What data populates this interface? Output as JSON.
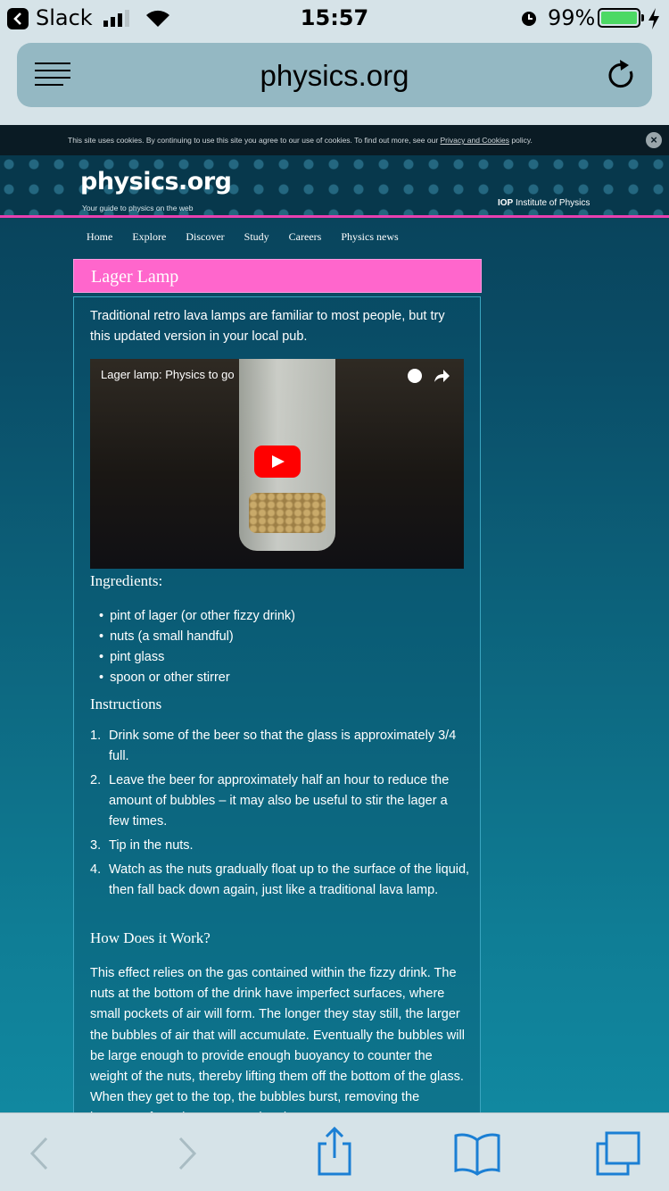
{
  "status_bar": {
    "back_app": "Slack",
    "time": "15:57",
    "battery": "99%"
  },
  "browser": {
    "url": "physics.org"
  },
  "cookie_banner": {
    "text_before": "This site uses cookies. By continuing to use this site you agree to our use of cookies. To find out more, see our ",
    "link": "Privacy and Cookies",
    "text_after": " policy.",
    "close": "×"
  },
  "site": {
    "logo": "physics.org",
    "tagline": "Your guide to physics on the web",
    "partner_abbr": "IOP",
    "partner": " Institute of Physics",
    "nav": [
      "Home",
      "Explore",
      "Discover",
      "Study",
      "Careers",
      "Physics news"
    ]
  },
  "article": {
    "title": "Lager Lamp",
    "intro": "Traditional retro lava lamps are familiar to most people, but try this updated version in your local pub.",
    "video_title": "Lager lamp: Physics to go",
    "ingredients_heading": "Ingredients:",
    "ingredients": [
      "pint of lager (or other fizzy drink)",
      "nuts (a small handful)",
      "pint glass",
      "spoon or other stirrer"
    ],
    "instructions_heading": "Instructions",
    "instructions": [
      "Drink some of the beer so that the glass is approximately 3/4 full.",
      "Leave the beer for approximately half an hour to reduce the amount of bubbles – it may also be useful to stir the lager a few times.",
      "Tip in the nuts.",
      "Watch as the nuts gradually float up to the surface of the liquid, then fall back down again, just like a traditional lava lamp."
    ],
    "how_heading": "How Does it Work?",
    "how_text": "This effect relies on the gas contained within the fizzy drink. The nuts at the bottom of the drink have imperfect surfaces, where small pockets of air will form. The longer they stay still, the larger the bubbles of air that will accumulate. Eventually the bubbles will be large enough to provide enough buoyancy to counter the weight of the nuts, thereby lifting them off the bottom of the glass. When they get to the top, the bubbles burst, removing the buoyancy from the nuts, causing them to"
  },
  "colors": {
    "accent_pink": "#ff66cc",
    "site_bg": "#0e6d85",
    "ios_bar": "#d6e3e8",
    "tint": "#1b7fd4"
  }
}
